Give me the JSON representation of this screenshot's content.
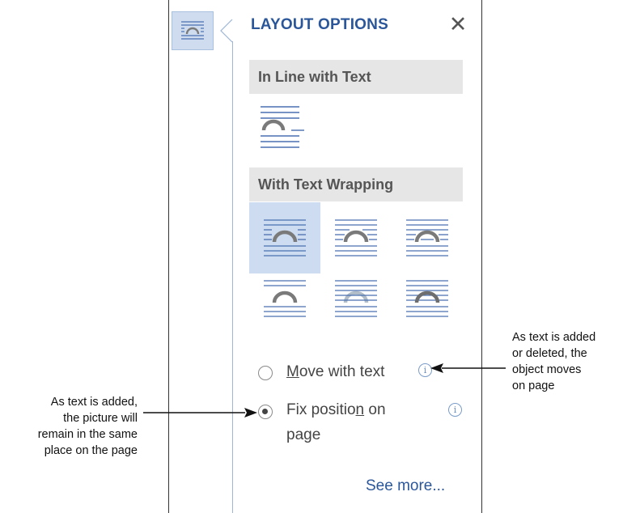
{
  "panel": {
    "title": "LAYOUT OPTIONS",
    "close_symbol": "✕",
    "sections": {
      "inline": {
        "header": "In Line with Text"
      },
      "wrapping": {
        "header": "With Text Wrapping"
      }
    },
    "selected_option": "square",
    "move_with_text": {
      "before": "",
      "underlined": "M",
      "after": "ove with text",
      "checked": false
    },
    "fix_position": {
      "before": "Fix positio",
      "underlined": "n",
      "after": " on",
      "line2": "page",
      "checked": true
    },
    "info_symbol": "i",
    "see_more": "See more..."
  },
  "callouts": {
    "left": [
      "As text is added,",
      "the picture will",
      "remain in the same",
      "place on the page"
    ],
    "right": [
      "As text is added",
      "or deleted, the",
      "object moves",
      "on page"
    ]
  },
  "colors": {
    "accent": "#2b579a",
    "selected_bg": "#cddcf0",
    "header_bg": "#e6e6e6",
    "icon_line": "#4a6fb0",
    "icon_arc": "#7a7a7a"
  }
}
